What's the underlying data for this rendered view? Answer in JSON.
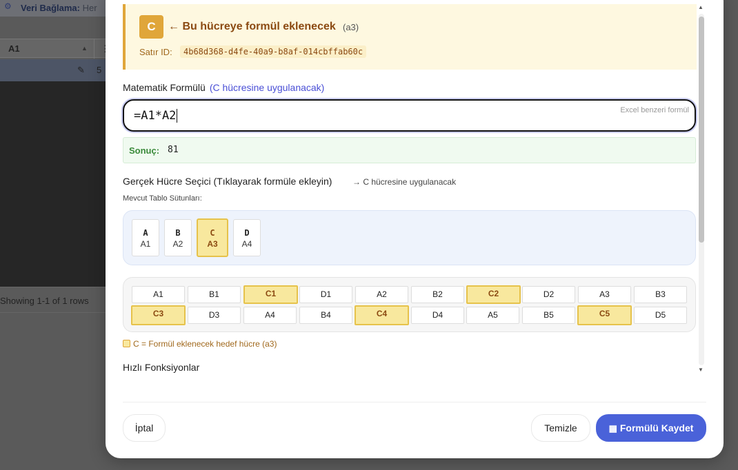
{
  "background": {
    "binding_label": "Veri Bağlama:",
    "binding_value": "Her",
    "column_a": "A1",
    "row_value": "5",
    "footer": "Showing 1-1 of 1 rows"
  },
  "target": {
    "badge": "C",
    "title": "← Bu hücreye formül eklenecek",
    "code": "(a3)",
    "row_id_label": "Satır ID:",
    "row_id": "4b68d368-d4fe-40a9-b8af-014cbffab60c"
  },
  "formula": {
    "label": "Matematik Formülü",
    "hint": "(C hücresine uygulanacak)",
    "value": "=A1*A2",
    "placeholder_hint": "Excel benzeri formül",
    "result_label": "Sonuç:",
    "result_value": "81"
  },
  "selector": {
    "title": "Gerçek Hücre Seçici (Tıklayarak formüle ekleyin)",
    "apply_note": "→ C hücresine uygulanacak",
    "columns_label": "Mevcut Tablo Sütunları:",
    "columns": [
      {
        "letter": "A",
        "cell": "A1",
        "active": false
      },
      {
        "letter": "B",
        "cell": "A2",
        "active": false
      },
      {
        "letter": "C",
        "cell": "A3",
        "active": true
      },
      {
        "letter": "D",
        "cell": "A4",
        "active": false
      }
    ],
    "cells": [
      {
        "label": "A1",
        "active": false
      },
      {
        "label": "B1",
        "active": false
      },
      {
        "label": "C1",
        "active": true
      },
      {
        "label": "D1",
        "active": false
      },
      {
        "label": "A2",
        "active": false
      },
      {
        "label": "B2",
        "active": false
      },
      {
        "label": "C2",
        "active": true
      },
      {
        "label": "D2",
        "active": false
      },
      {
        "label": "A3",
        "active": false
      },
      {
        "label": "B3",
        "active": false
      },
      {
        "label": "C3",
        "active": true
      },
      {
        "label": "D3",
        "active": false
      },
      {
        "label": "A4",
        "active": false
      },
      {
        "label": "B4",
        "active": false
      },
      {
        "label": "C4",
        "active": true
      },
      {
        "label": "D4",
        "active": false
      },
      {
        "label": "A5",
        "active": false
      },
      {
        "label": "B5",
        "active": false
      },
      {
        "label": "C5",
        "active": true
      },
      {
        "label": "D5",
        "active": false
      }
    ],
    "legend": "C = Formül eklenecek hedef hücre (a3)"
  },
  "quick_functions_title": "Hızlı Fonksiyonlar",
  "buttons": {
    "cancel": "İptal",
    "clear": "Temizle",
    "save": "Formülü Kaydet",
    "save_icon": "abacus-icon"
  },
  "colors": {
    "accent": "#4a62d9",
    "target": "#e0a63a",
    "highlight": "#f8e89e",
    "result_text": "#3a8a3a"
  }
}
